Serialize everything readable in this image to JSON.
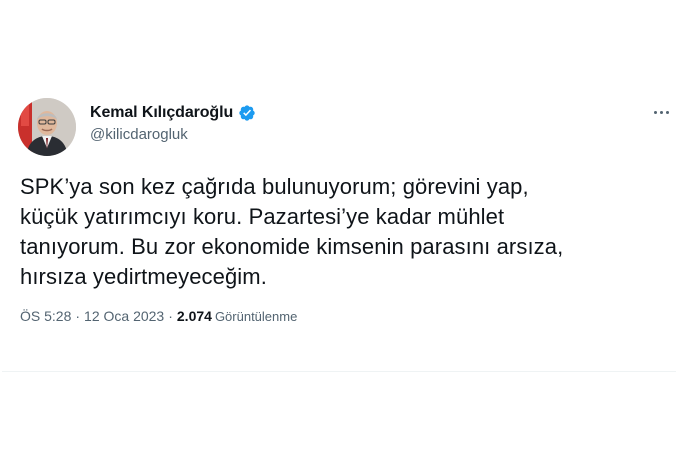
{
  "tweet": {
    "author": {
      "display_name": "Kemal Kılıçdaroğlu",
      "handle": "@kilicdarogluk",
      "verified": true
    },
    "more_menu_icon": "more-horizontal-icon",
    "text_lines": [
      "SPK’ya son kez çağrıda bulunuyorum; görevini yap,",
      "küçük yatırımcıyı koru. Pazartesi’ye kadar mühlet",
      "tanıyorum. Bu zor ekonomide kimsenin parasını arsıza,",
      "hırsıza yedirtmeyeceğim."
    ],
    "meta": {
      "time": "ÖS 5:28",
      "separator": "·",
      "date": "12 Oca 2023",
      "views_count": "2.074",
      "views_label": "Görüntülenme"
    }
  },
  "colors": {
    "primary_text": "#0f1419",
    "secondary_text": "#536471",
    "verified_badge": "#1d9bf0",
    "divider": "#eff3f4"
  }
}
